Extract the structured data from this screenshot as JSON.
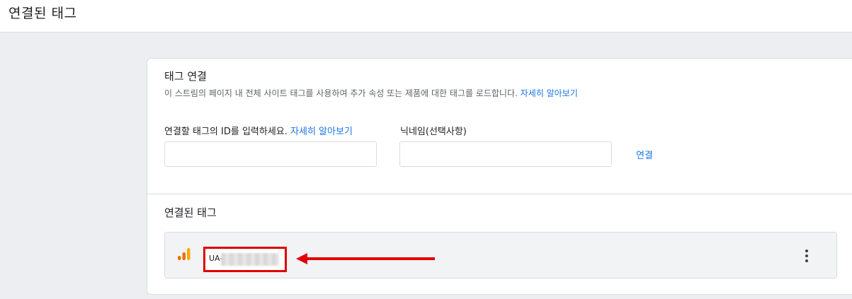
{
  "header": {
    "title": "연결된 태그"
  },
  "tag_connect": {
    "title": "태그 연결",
    "description": "이 스트림의 페이지 내 전체 사이트 태그를 사용하여 추가 속성 또는 제품에 대한 태그를 로드합니다.",
    "learn_more": "자세히 알아보기",
    "tag_id_label": "연결할 태그의 ID를 입력하세요.",
    "tag_id_learn_more": "자세히 알아보기",
    "nickname_label": "닉네임(선택사항)",
    "tag_id_value": "",
    "nickname_value": "",
    "connect_button": "연결"
  },
  "connected_tags": {
    "title": "연결된 태그",
    "items": [
      {
        "id_prefix": "UA-",
        "icon": "analytics-icon"
      }
    ]
  },
  "annotation": {
    "highlight_color": "#e00000",
    "arrow_color": "#e00000"
  },
  "colors": {
    "accent": "#1a73e8",
    "analytics_orange": "#e8710a",
    "analytics_yellow": "#f9ab00"
  }
}
